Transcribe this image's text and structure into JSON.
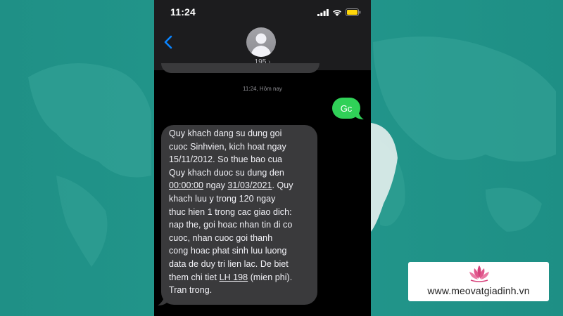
{
  "status_bar": {
    "time": "11:24"
  },
  "header": {
    "contact_name": "195",
    "contact_chevron": "›"
  },
  "conversation": {
    "timestamp": "11:24, Hôm nay",
    "sent_message": "Gc",
    "received_message": {
      "line1": "Quy khach dang su dung goi",
      "line2": "cuoc Sinhvien, kich hoat ngay",
      "line3": "15/11/2012. So thue bao cua",
      "line4": "Quy khach duoc su dung den",
      "time_link": "00:00:00",
      "ngay": " ngay ",
      "date_link": "31/03/2021",
      "line5_end": ". Quy",
      "line6": "khach luu y trong 120 ngay",
      "line7": "thuc hien 1 trong cac giao dich:",
      "line8": "nap the, goi hoac nhan tin di co",
      "line9": "cuoc, nhan cuoc goi thanh",
      "line10": "cong hoac phat sinh luu luong",
      "line11": "data de duy tri lien lac. De biet",
      "line12_start": "them chi tiet ",
      "phone_link": "LH 198",
      "line12_end": " (mien phi).",
      "line13": "Tran trong."
    }
  },
  "watermark": {
    "text": "www.meovatgiadinh.vn"
  },
  "colors": {
    "background_teal": "#1e8f85",
    "imessage_green": "#30d158",
    "ios_blue": "#0a84ff",
    "bubble_gray": "#3a3a3c",
    "lotus_pink": "#d6407a"
  },
  "icons": [
    "cellular-signal-icon",
    "wifi-icon",
    "battery-icon",
    "back-chevron-icon",
    "person-avatar-icon",
    "lotus-logo-icon"
  ]
}
